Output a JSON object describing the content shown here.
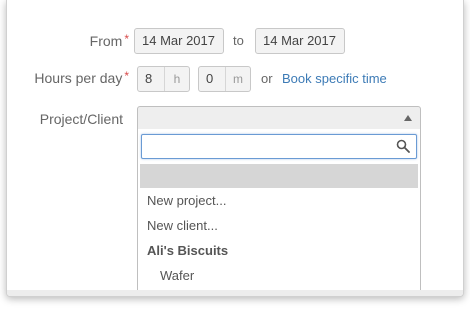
{
  "form": {
    "from": {
      "label": "From",
      "required_mark": "*",
      "start_date": "14 Mar 2017",
      "separator": "to",
      "end_date": "14 Mar 2017"
    },
    "hours_per_day": {
      "label": "Hours per day",
      "required_mark": "*",
      "hours_value": "8",
      "hours_unit": "h",
      "minutes_value": "0",
      "minutes_unit": "m",
      "or_text": "or",
      "book_specific_link": "Book specific time"
    },
    "project_client": {
      "label": "Project/Client",
      "selected_value": "",
      "search_value": "",
      "options": [
        {
          "label": "New project...",
          "type": "action"
        },
        {
          "label": "New client...",
          "type": "action"
        },
        {
          "label": "Ali's Biscuits",
          "type": "group"
        },
        {
          "label": "Wafer",
          "type": "project"
        }
      ]
    }
  },
  "colors": {
    "link": "#3d7bb6",
    "required": "#d84a4a",
    "focus_border": "#6a9bd4",
    "highlight": "#d6d6d6"
  }
}
